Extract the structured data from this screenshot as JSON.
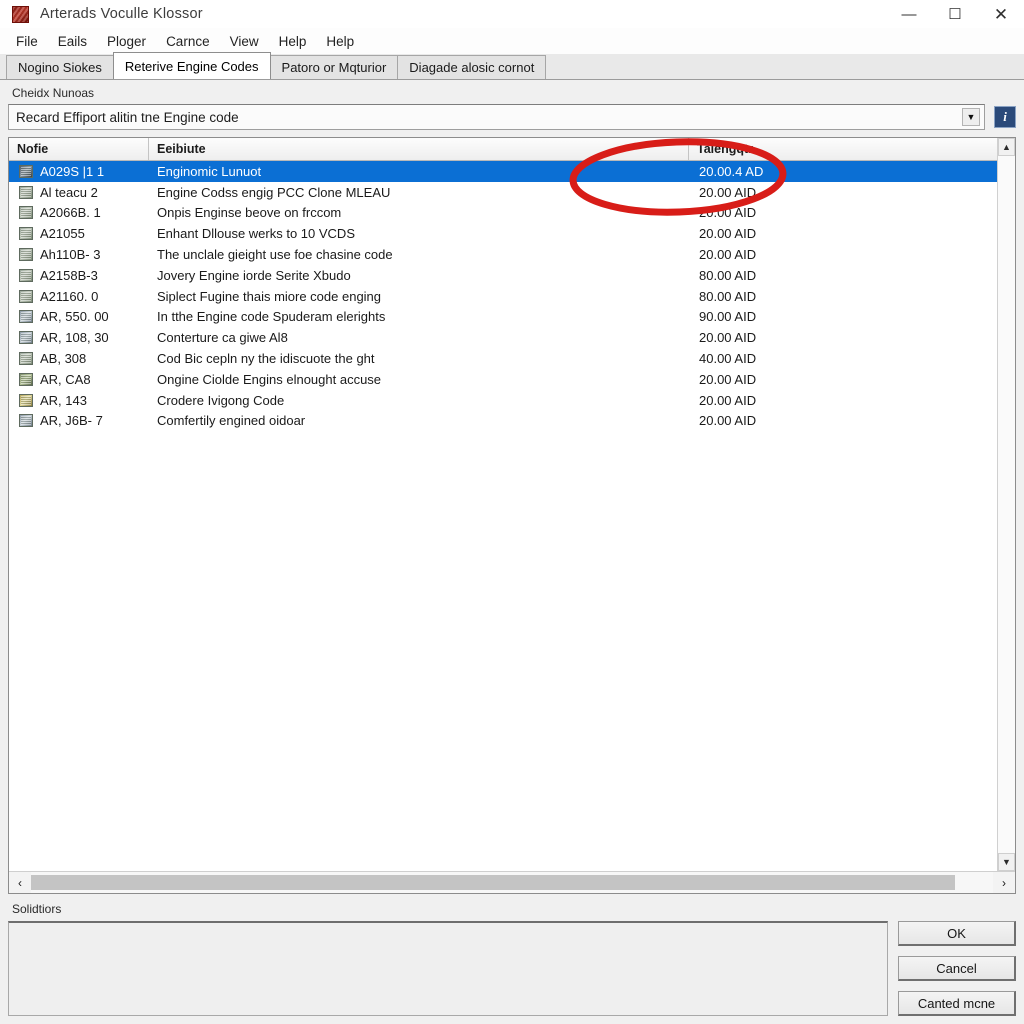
{
  "window": {
    "title": "Arterads Voculle Klossor",
    "icon": "app-icon",
    "minimize": "—",
    "maximize": "☐",
    "close": "✕"
  },
  "menubar": {
    "items": [
      {
        "label": "File"
      },
      {
        "label": "Eails"
      },
      {
        "label": "Ploger"
      },
      {
        "label": "Carnce"
      },
      {
        "label": "View"
      },
      {
        "label": "Help"
      },
      {
        "label": "Help"
      }
    ]
  },
  "tabs": [
    {
      "label": "Nogino Siokes",
      "active": false
    },
    {
      "label": "Reterive Engine Codes",
      "active": true
    },
    {
      "label": "Patoro or Mqturior",
      "active": false
    },
    {
      "label": "Diagade alosic cornot",
      "active": false
    }
  ],
  "group": {
    "label": "Cheidx Nunoas"
  },
  "combo": {
    "value": "Recard Effiport alitin tne  Engine code",
    "placeholder": "Recard Effiport alitin tne  Engine code",
    "arrow_icon": "▼",
    "info_label": "i"
  },
  "list": {
    "columns": [
      {
        "key": "name",
        "label": "Nofie"
      },
      {
        "key": "desc",
        "label": "Eeibiute"
      },
      {
        "key": "type",
        "label": "Talengqtr"
      }
    ],
    "rows": [
      {
        "name": "A029S |1 1",
        "desc": "Enginomic Lunuot",
        "type": "20.00.4 AD",
        "selected": true,
        "icon": "sel"
      },
      {
        "name": "Al teacu 2",
        "desc": "Engine Codss engig PCC Clone MLEAU",
        "type": "20.00 AID",
        "selected": false,
        "icon": "v1"
      },
      {
        "name": "A2066B. 1",
        "desc": "Onpis Enginse beove on frccom",
        "type": "20.00 AID",
        "selected": false,
        "icon": "v1"
      },
      {
        "name": "A21055",
        "desc": "Enhant Dllouse werks to 10 VCDS",
        "type": "20.00 AID",
        "selected": false,
        "icon": "v1"
      },
      {
        "name": "Ah110B- 3",
        "desc": "The unclale gieight use foe chasine code",
        "type": "20.00 AID",
        "selected": false,
        "icon": "v1"
      },
      {
        "name": "A2158B-3",
        "desc": "Jovery Engine iorde Serite Xbudo",
        "type": "80.00 AID",
        "selected": false,
        "icon": "v1"
      },
      {
        "name": "A21160. 0",
        "desc": "Siplect Fugine thais miore code enging",
        "type": "80.00 AID",
        "selected": false,
        "icon": "v1"
      },
      {
        "name": "AR, 550. 00",
        "desc": "In tthe Engine code Spuderam elerights",
        "type": "90.00 AID",
        "selected": false,
        "icon": "v2"
      },
      {
        "name": "AR, 108, 30",
        "desc": "Conterture ca giwe Al8",
        "type": "20.00 AID",
        "selected": false,
        "icon": "v2"
      },
      {
        "name": "AB, 308",
        "desc": "Cod Bic cepln ny the idiscuote the ght",
        "type": "40.00 AID",
        "selected": false,
        "icon": "v1"
      },
      {
        "name": "AR, CA8",
        "desc": "Ongine Ciolde Engins elnought accuse",
        "type": "20.00 AID",
        "selected": false,
        "icon": "v3"
      },
      {
        "name": "AR, 143",
        "desc": "Crodere Ivigong Code",
        "type": "20.00 AID",
        "selected": false,
        "icon": "v4"
      },
      {
        "name": "AR, J6B- 7",
        "desc": "Comfertily engined oidoar",
        "type": "20.00 AID",
        "selected": false,
        "icon": "v2"
      }
    ],
    "scroll": {
      "up_icon": "▲",
      "down_icon": "▼",
      "left_icon": "‹",
      "right_icon": "›"
    }
  },
  "solutions": {
    "label": "Solidtiors",
    "text": ""
  },
  "buttons": [
    {
      "label": "OK"
    },
    {
      "label": "Cancel"
    },
    {
      "label": "Canted mcne"
    }
  ],
  "annotation": {
    "shape": "ellipse",
    "color": "#d81d18",
    "target": "Talengqtr column value 20.00.4 AD"
  },
  "colors": {
    "selection": "#0b6fd4",
    "annotation": "#d81d18",
    "info_button": "#2b4a7a",
    "window_bg": "#f0f0f0"
  }
}
